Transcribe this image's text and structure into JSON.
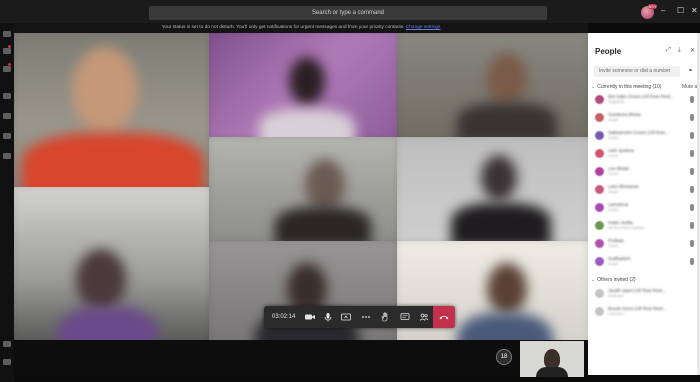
{
  "topbar": {
    "search_placeholder": "Search or type a command",
    "avatar_badge": "BSY",
    "minimize": "–",
    "maximize": "☐",
    "close": "✕"
  },
  "notice": {
    "text": "Your status is set to do not disturb. You'll only get notifications for urgent messages and from your priority contacts.",
    "link": "Change settings"
  },
  "controls": {
    "timer": "03:02:14",
    "camera_icon": "camera-icon",
    "mic_icon": "microphone-icon",
    "share_icon": "share-screen-icon",
    "more_icon": "more-icon",
    "hand_icon": "raise-hand-icon",
    "chat_icon": "chat-icon",
    "people_icon": "participants-icon",
    "hangup_icon": "hang-up-icon"
  },
  "bottom": {
    "participant_count": "18"
  },
  "people_panel": {
    "title": "People",
    "invite_placeholder": "Invite someone or dial a number",
    "section_current": "Currently in this meeting (10)",
    "mute_all": "Mute all",
    "section_others": "Others invited (2)",
    "participants": [
      {
        "name": "Bet Sabo Grann (All Row Rest...",
        "role": "Organizer",
        "color": "#b34a7a"
      },
      {
        "name": "Gordeora Bheta",
        "role": "Guest",
        "color": "#c4606a"
      },
      {
        "name": "Sabsamohn Grann (All Row...",
        "role": "Guest",
        "color": "#7a5ab0"
      },
      {
        "name": "Ashi Jyotivra",
        "role": "Guest",
        "color": "#d05570"
      },
      {
        "name": "Lao Bhala",
        "role": "Guest",
        "color": "#b040a0"
      },
      {
        "name": "Leko Bhetanan",
        "role": "Guest",
        "color": "#c85a80"
      },
      {
        "name": "Lamolena",
        "role": "Guest",
        "color": "#a84ab0"
      },
      {
        "name": "Inaitu Joolta",
        "role": "All Row Rest Institute",
        "color": "#6a9a50"
      },
      {
        "name": "Podiaat",
        "role": "Guest",
        "color": "#b050b0"
      },
      {
        "name": "Sudhadarri",
        "role": "Guest",
        "color": "#9a5ac0"
      }
    ],
    "others": [
      {
        "name": "Jaudh Jaam (All Row Rest...",
        "role": "Unknown",
        "color": "#c4c4c4"
      },
      {
        "name": "Bouds Geon (All Row Rest...",
        "role": "Unknown",
        "color": "#c4c4c4"
      }
    ]
  }
}
